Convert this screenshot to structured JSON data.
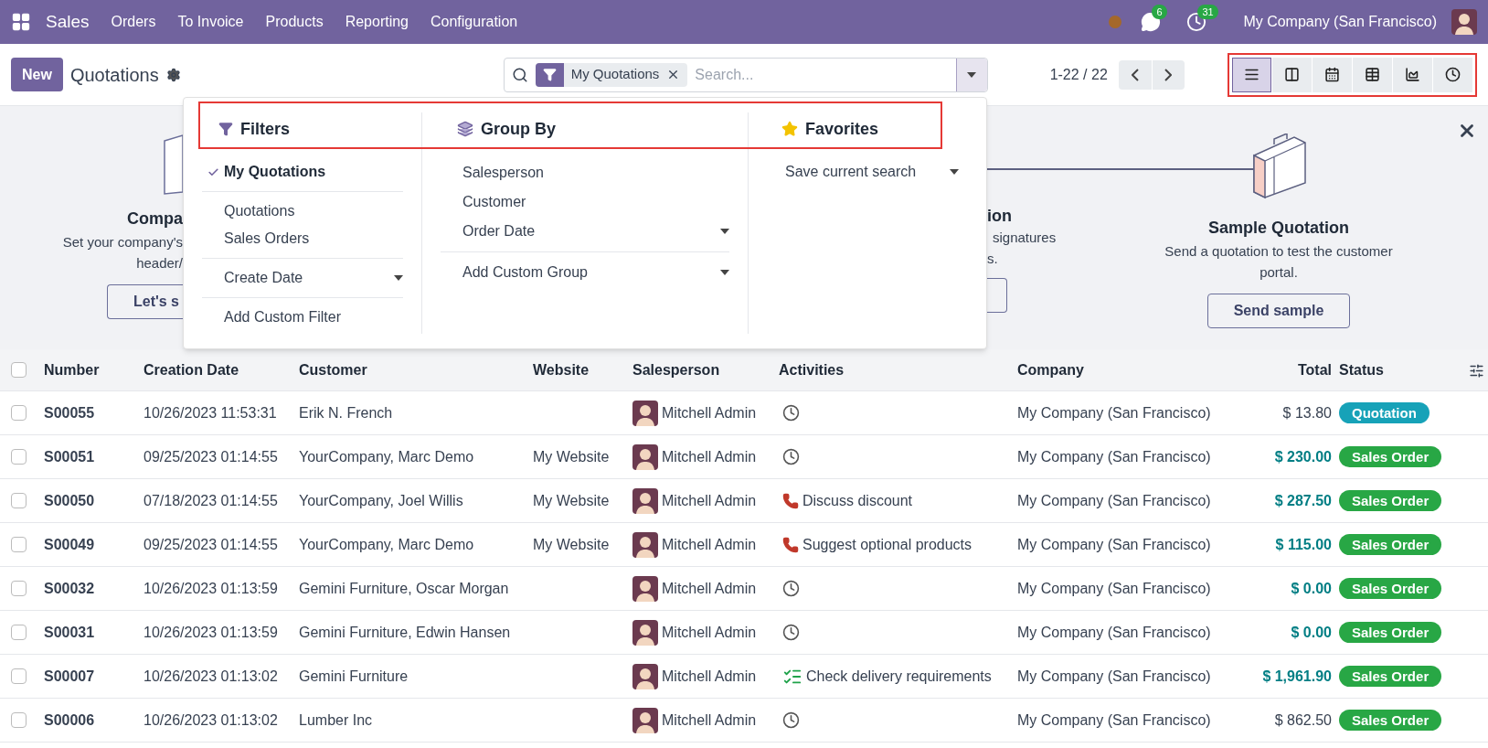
{
  "navbar": {
    "app": "Sales",
    "menu": [
      "Orders",
      "To Invoice",
      "Products",
      "Reporting",
      "Configuration"
    ],
    "messages_badge": "6",
    "activities_badge": "31",
    "company": "My Company (San Francisco)"
  },
  "control_panel": {
    "new_button": "New",
    "title": "Quotations",
    "search": {
      "facet": "My Quotations",
      "placeholder": "Search..."
    },
    "pager": "1-22 / 22",
    "views": [
      {
        "kind": "list",
        "selected": true
      },
      {
        "kind": "kanban",
        "selected": false
      },
      {
        "kind": "calendar",
        "selected": false
      },
      {
        "kind": "pivot",
        "selected": false
      },
      {
        "kind": "graph",
        "selected": false
      },
      {
        "kind": "activity",
        "selected": false
      }
    ]
  },
  "search_panel": {
    "filters": {
      "title": "Filters",
      "groups": [
        [
          {
            "label": "My Quotations",
            "checked": true,
            "has_options": false
          }
        ],
        [
          {
            "label": "Quotations",
            "checked": false,
            "has_options": false
          },
          {
            "label": "Sales Orders",
            "checked": false,
            "has_options": false
          }
        ],
        [
          {
            "label": "Create Date",
            "checked": false,
            "has_options": true
          }
        ],
        [
          {
            "label": "Add Custom Filter",
            "checked": false,
            "has_options": false
          }
        ]
      ]
    },
    "group_by": {
      "title": "Group By",
      "groups": [
        [
          {
            "label": "Salesperson",
            "has_options": false
          },
          {
            "label": "Customer",
            "has_options": false
          },
          {
            "label": "Order Date",
            "has_options": true
          }
        ],
        [
          {
            "label": "Add Custom Group",
            "has_options": true
          }
        ]
      ]
    },
    "favorites": {
      "title": "Favorites",
      "items": [
        {
          "label": "Save current search",
          "has_options": true
        }
      ]
    }
  },
  "banner": {
    "left_step": {
      "title": "Compa",
      "lines": [
        "Set your company's",
        "header/"
      ],
      "button": "Let's s"
    },
    "middle_step": {
      "title": "ion",
      "lines": [
        "signatures",
        "s."
      ]
    },
    "last_step": {
      "title": "Sample Quotation",
      "lines": [
        "Send a quotation to test the customer",
        "portal."
      ],
      "button": "Send sample"
    }
  },
  "table": {
    "select_all_checked": false,
    "columns": [
      "Number",
      "Creation Date",
      "Customer",
      "Website",
      "Salesperson",
      "Activities",
      "Company",
      "Total",
      "Status"
    ],
    "rows": [
      {
        "checked": false,
        "number": "S00055",
        "date": "10/26/2023 11:53:31",
        "customer": "Erik N. French",
        "website": "",
        "salesperson": "Mitchell Admin",
        "activity": {
          "kind": "clock"
        },
        "company": "My Company (San Francisco)",
        "total": "$ 13.80",
        "total_emphasis": false,
        "status": {
          "label": "Quotation",
          "kind": "quotation"
        }
      },
      {
        "checked": false,
        "number": "S00051",
        "date": "09/25/2023 01:14:55",
        "customer": "YourCompany, Marc Demo",
        "website": "My Website",
        "salesperson": "Mitchell Admin",
        "activity": {
          "kind": "clock"
        },
        "company": "My Company (San Francisco)",
        "total": "$ 230.00",
        "total_emphasis": true,
        "status": {
          "label": "Sales Order",
          "kind": "order"
        }
      },
      {
        "checked": false,
        "number": "S00050",
        "date": "07/18/2023 01:14:55",
        "customer": "YourCompany, Joel Willis",
        "website": "My Website",
        "salesperson": "Mitchell Admin",
        "activity": {
          "kind": "call",
          "text": "Discuss discount"
        },
        "company": "My Company (San Francisco)",
        "total": "$ 287.50",
        "total_emphasis": true,
        "status": {
          "label": "Sales Order",
          "kind": "order"
        }
      },
      {
        "checked": false,
        "number": "S00049",
        "date": "09/25/2023 01:14:55",
        "customer": "YourCompany, Marc Demo",
        "website": "My Website",
        "salesperson": "Mitchell Admin",
        "activity": {
          "kind": "call",
          "text": "Suggest optional products"
        },
        "company": "My Company (San Francisco)",
        "total": "$ 115.00",
        "total_emphasis": true,
        "status": {
          "label": "Sales Order",
          "kind": "order"
        }
      },
      {
        "checked": false,
        "number": "S00032",
        "date": "10/26/2023 01:13:59",
        "customer": "Gemini Furniture, Oscar Morgan",
        "website": "",
        "salesperson": "Mitchell Admin",
        "activity": {
          "kind": "clock"
        },
        "company": "My Company (San Francisco)",
        "total": "$ 0.00",
        "total_emphasis": true,
        "status": {
          "label": "Sales Order",
          "kind": "order"
        }
      },
      {
        "checked": false,
        "number": "S00031",
        "date": "10/26/2023 01:13:59",
        "customer": "Gemini Furniture, Edwin Hansen",
        "website": "",
        "salesperson": "Mitchell Admin",
        "activity": {
          "kind": "clock"
        },
        "company": "My Company (San Francisco)",
        "total": "$ 0.00",
        "total_emphasis": true,
        "status": {
          "label": "Sales Order",
          "kind": "order"
        }
      },
      {
        "checked": false,
        "number": "S00007",
        "date": "10/26/2023 01:13:02",
        "customer": "Gemini Furniture",
        "website": "",
        "salesperson": "Mitchell Admin",
        "activity": {
          "kind": "todo",
          "text": "Check delivery requirements"
        },
        "company": "My Company (San Francisco)",
        "total": "$ 1,961.90",
        "total_emphasis": true,
        "status": {
          "label": "Sales Order",
          "kind": "order"
        }
      },
      {
        "checked": false,
        "number": "S00006",
        "date": "10/26/2023 01:13:02",
        "customer": "Lumber Inc",
        "website": "",
        "salesperson": "Mitchell Admin",
        "activity": {
          "kind": "clock"
        },
        "company": "My Company (San Francisco)",
        "total": "$ 862.50",
        "total_emphasis": false,
        "status": {
          "label": "Sales Order",
          "kind": "order"
        }
      }
    ]
  }
}
